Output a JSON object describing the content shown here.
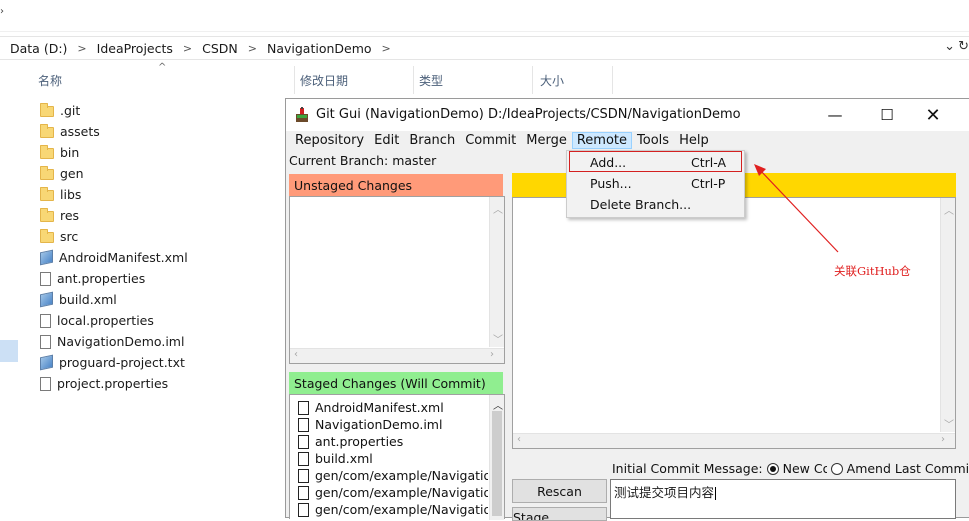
{
  "explorer": {
    "breadcrumb": [
      "Data (D:)",
      "IdeaProjects",
      "CSDN",
      "NavigationDemo"
    ],
    "columns": [
      "名称",
      "修改日期",
      "类型",
      "大小"
    ],
    "files": [
      {
        "name": ".git",
        "icon": "folder-icon"
      },
      {
        "name": "assets",
        "icon": "folder-icon"
      },
      {
        "name": "bin",
        "icon": "folder-icon"
      },
      {
        "name": "gen",
        "icon": "folder-icon"
      },
      {
        "name": "libs",
        "icon": "folder-icon"
      },
      {
        "name": "res",
        "icon": "folder-icon"
      },
      {
        "name": "src",
        "icon": "folder-icon"
      },
      {
        "name": "AndroidManifest.xml",
        "icon": "xml-file-icon"
      },
      {
        "name": "ant.properties",
        "icon": "file-icon"
      },
      {
        "name": "build.xml",
        "icon": "xml-file-icon"
      },
      {
        "name": "local.properties",
        "icon": "file-icon"
      },
      {
        "name": "NavigationDemo.iml",
        "icon": "file-icon"
      },
      {
        "name": "proguard-project.txt",
        "icon": "xml-file-icon"
      },
      {
        "name": "project.properties",
        "icon": "file-icon"
      }
    ]
  },
  "gitgui": {
    "title": "Git Gui (NavigationDemo) D:/IdeaProjects/CSDN/NavigationDemo",
    "menu": [
      "Repository",
      "Edit",
      "Branch",
      "Commit",
      "Merge",
      "Remote",
      "Tools",
      "Help"
    ],
    "current_branch": "Current Branch: master",
    "unstaged_header": "Unstaged Changes",
    "staged_header": "Staged Changes (Will Commit)",
    "staged_files": [
      "AndroidManifest.xml",
      "NavigationDemo.iml",
      "ant.properties",
      "build.xml",
      "gen/com/example/NavigationDemo",
      "gen/com/example/NavigationDemo",
      "gen/com/example/NavigationDemo"
    ],
    "commit_message_label": "Initial Commit Message:",
    "new_commit_label": "New Commit",
    "amend_label": "Amend Last Commit",
    "rescan_label": "Rescan",
    "stage_changed_label": "Stage Changed",
    "commit_message": "测试提交项目内容"
  },
  "remote_menu": {
    "items": [
      {
        "label": "Add...",
        "shortcut": "Ctrl-A"
      },
      {
        "label": "Push...",
        "shortcut": "Ctrl-P"
      },
      {
        "label": "Delete Branch...",
        "shortcut": ""
      }
    ]
  },
  "annotation": {
    "text": "关联GitHub仓"
  },
  "colors": {
    "unstaged": "#ff9a79",
    "staged": "#90ee90",
    "diff_header": "#ffd700",
    "annotation": "#e02020"
  }
}
